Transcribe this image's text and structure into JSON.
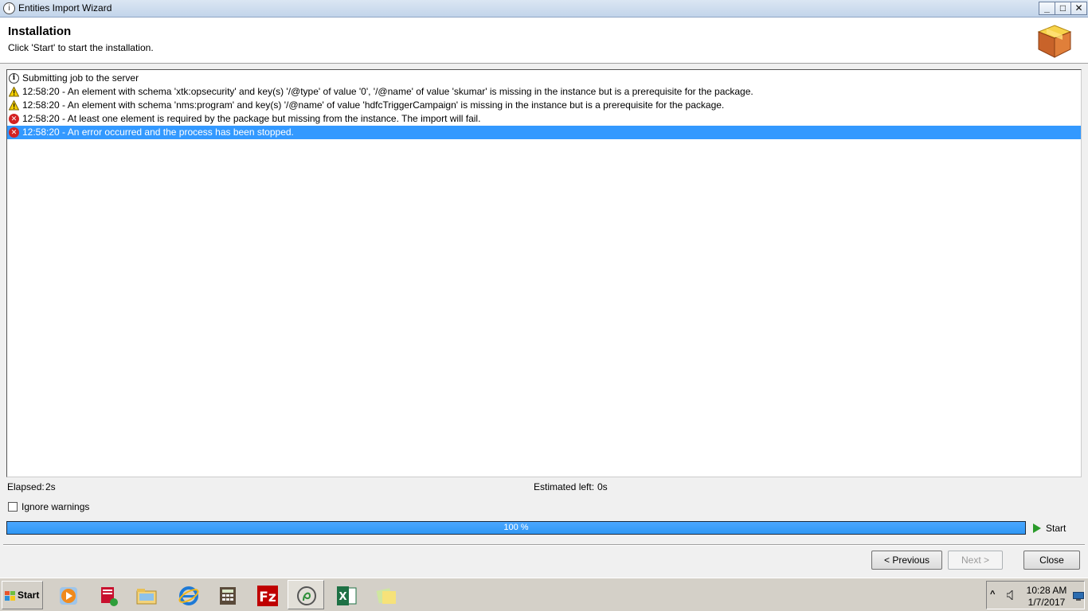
{
  "window": {
    "title": "Entities Import Wizard",
    "controls": {
      "minimize": "_",
      "maximize": "□",
      "close": "✕"
    }
  },
  "header": {
    "title": "Installation",
    "subtitle": "Click 'Start' to start the installation."
  },
  "log": [
    {
      "type": "info",
      "icon": "info-icon",
      "text": "Submitting job to the server"
    },
    {
      "type": "warning",
      "icon": "warning-icon",
      "text": "12:58:20 - An element with schema 'xtk:opsecurity' and key(s) '/@type' of value '0', '/@name' of value 'skumar' is missing in the instance but is a prerequisite for the package."
    },
    {
      "type": "warning",
      "icon": "warning-icon",
      "text": "12:58:20 - An element with schema 'nms:program' and key(s) '/@name' of value 'hdfcTriggerCampaign' is missing in the instance but is a prerequisite for the package."
    },
    {
      "type": "error",
      "icon": "error-icon",
      "text": "12:58:20 - At least one element is required by the package but missing from the instance. The import will fail."
    },
    {
      "type": "error",
      "icon": "error-icon",
      "text": "12:58:20 - An error occurred and the process has been stopped.",
      "selected": true
    }
  ],
  "status": {
    "elapsed_label": "Elapsed:",
    "elapsed_value": "2s",
    "estimated_label": "Estimated left:",
    "estimated_value": "0s",
    "ignore_warnings_label": "Ignore warnings",
    "ignore_warnings_checked": false
  },
  "progress": {
    "value_percent": 100,
    "text": "100 %",
    "color": "#3399ff"
  },
  "actions": {
    "start_label": "Start",
    "previous_label": "< Previous",
    "next_label": "Next >",
    "close_label": "Close"
  },
  "taskbar": {
    "start_label": "Start",
    "apps": [
      {
        "name": "media-player-icon"
      },
      {
        "name": "archive-installer-icon"
      },
      {
        "name": "file-explorer-icon"
      },
      {
        "name": "internet-explorer-icon"
      },
      {
        "name": "calculator-icon"
      },
      {
        "name": "filezilla-icon"
      },
      {
        "name": "campaign-client-icon",
        "active": true
      },
      {
        "name": "excel-icon"
      },
      {
        "name": "sticky-notes-icon"
      }
    ],
    "clock_time": "10:28 AM",
    "clock_date": "1/7/2017"
  },
  "colors": {
    "selection": "#3399ff",
    "error": "#d42222",
    "warning": "#f5d000",
    "start_arrow": "#2a9a2a"
  }
}
